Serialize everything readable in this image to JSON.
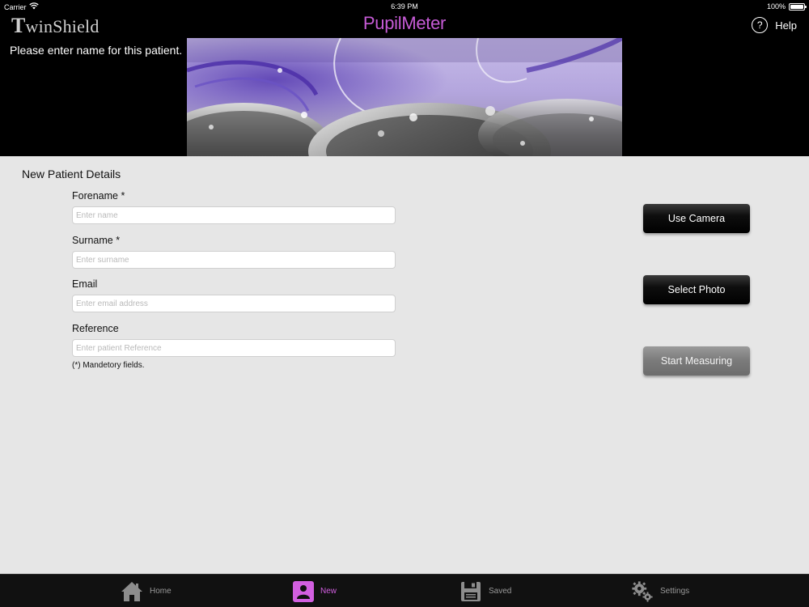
{
  "status_bar": {
    "carrier": "Carrier",
    "time": "6:39 PM",
    "battery": "100%",
    "wifi_icon": "wifi-icon",
    "battery_icon": "battery-icon"
  },
  "header": {
    "brand_initial": "T",
    "brand_rest": "winShield",
    "app_title": "PupilMeter",
    "help_label": "Help",
    "help_icon": "question-circle-icon",
    "prompt": "Please enter name for this patient."
  },
  "form": {
    "section_title": "New Patient Details",
    "fields": [
      {
        "label": "Forename *",
        "value": "",
        "placeholder": "Enter name"
      },
      {
        "label": "Surname *",
        "value": "",
        "placeholder": "Enter surname"
      },
      {
        "label": "Email",
        "value": "",
        "placeholder": "Enter email address"
      },
      {
        "label": "Reference",
        "value": "",
        "placeholder": "Enter patient Reference"
      }
    ],
    "mandatory_note": "(*) Mandetory fields."
  },
  "actions": {
    "use_camera": "Use Camera",
    "select_photo": "Select Photo",
    "start_measuring": "Start Measuring"
  },
  "tabs": [
    {
      "label": "Home",
      "icon": "home-icon",
      "active": false
    },
    {
      "label": "New",
      "icon": "person-icon",
      "active": true
    },
    {
      "label": "Saved",
      "icon": "floppy-disk-icon",
      "active": false
    },
    {
      "label": "Settings",
      "icon": "gears-icon",
      "active": false
    }
  ],
  "colors": {
    "accent": "#c65bd6",
    "active_tab": "#d25fe0",
    "background": "#e6e6e6",
    "header_bg": "#000000"
  }
}
